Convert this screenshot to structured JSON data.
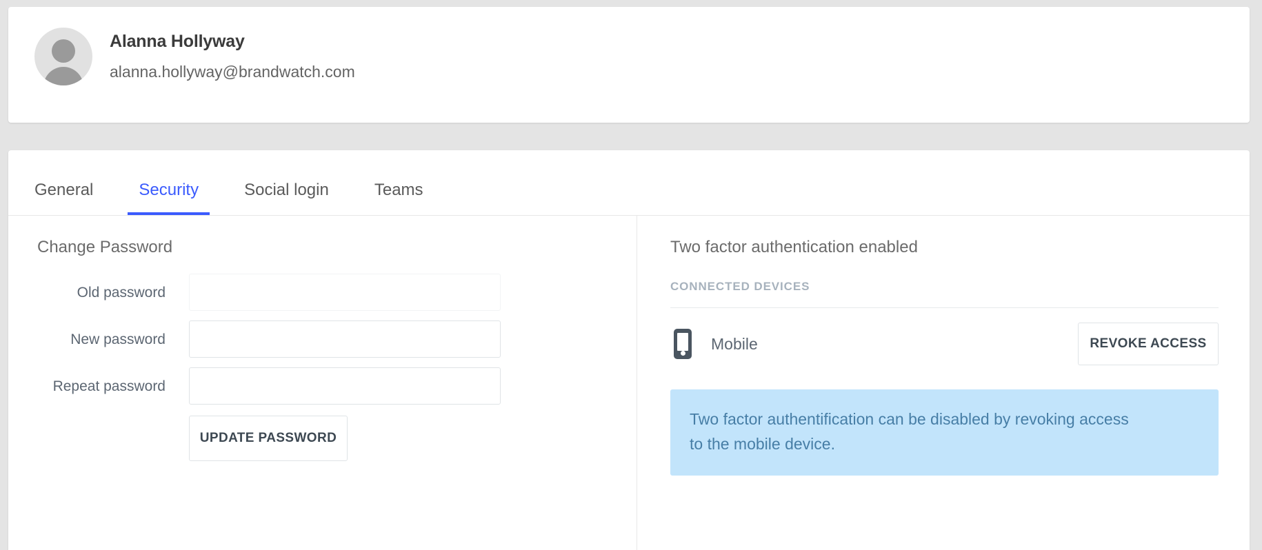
{
  "profile": {
    "name": "Alanna Hollyway",
    "email": "alanna.hollyway@brandwatch.com",
    "avatar_icon": "user-avatar-icon"
  },
  "tabs": [
    {
      "label": "General",
      "active": false
    },
    {
      "label": "Security",
      "active": true
    },
    {
      "label": "Social login",
      "active": false
    },
    {
      "label": "Teams",
      "active": false
    }
  ],
  "change_password": {
    "title": "Change Password",
    "fields": [
      {
        "label": "Old password",
        "value": "",
        "placeholder": ""
      },
      {
        "label": "New password",
        "value": "",
        "placeholder": ""
      },
      {
        "label": "Repeat password",
        "value": "",
        "placeholder": ""
      }
    ],
    "submit_label": "UPDATE PASSWORD"
  },
  "two_factor": {
    "title": "Two factor authentication enabled",
    "connected_devices_label": "CONNECTED DEVICES",
    "devices": [
      {
        "name": "Mobile",
        "icon": "mobile-phone-icon",
        "action_label": "REVOKE ACCESS"
      }
    ],
    "info_message": "Two factor authentification can be disabled by revoking access to the mobile device."
  },
  "colors": {
    "accent_blue": "#3b5bfd",
    "page_background": "#e4e4e4",
    "card_background": "#ffffff",
    "info_banner_background": "#c2e4fb",
    "info_banner_text": "#477ea6",
    "muted_label": "#a7b2bd",
    "body_text": "#5c6672"
  }
}
